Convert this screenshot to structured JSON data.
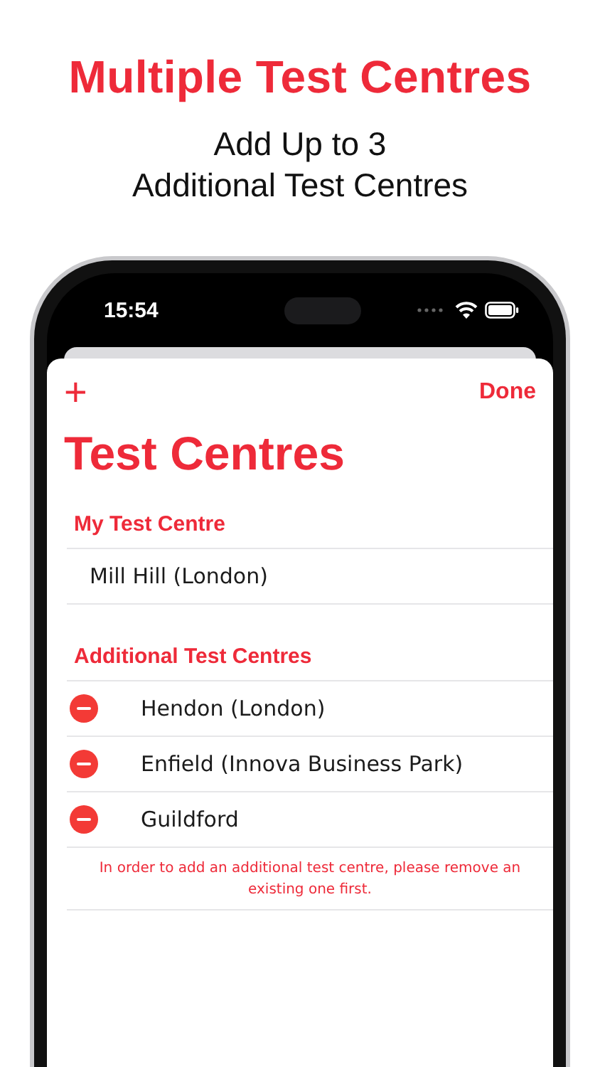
{
  "headline": "Multiple Test Centres",
  "subtitle_lines": [
    "Add Up to 3",
    "Additional Test Centres"
  ],
  "status_bar": {
    "time": "15:54"
  },
  "nav": {
    "add_symbol": "+",
    "done": "Done"
  },
  "title": "Test Centres",
  "my_section": {
    "header": "My Test Centre",
    "items": [
      {
        "name": "Mill Hill (London)"
      }
    ]
  },
  "additional_section": {
    "header": "Additional Test Centres",
    "items": [
      {
        "name": "Hendon (London)"
      },
      {
        "name": "Enfield (Innova Business Park)"
      },
      {
        "name": "Guildford"
      }
    ],
    "footer": "In order to add an additional test centre, please remove an existing one first."
  }
}
